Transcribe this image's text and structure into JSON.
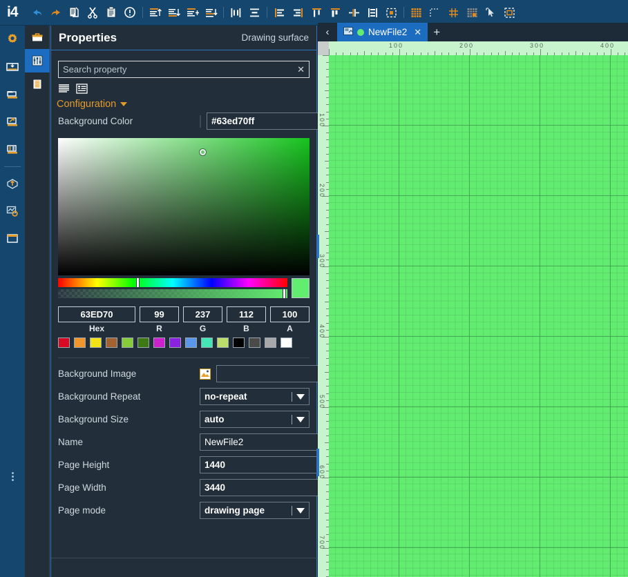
{
  "app": {
    "brand": "i4"
  },
  "toolbar": {
    "items": [
      {
        "name": "undo-icon",
        "label": "Undo"
      },
      {
        "name": "redo-icon",
        "label": "Redo"
      },
      {
        "name": "copy-icon",
        "label": "Copy"
      },
      {
        "name": "cut-icon",
        "label": "Cut"
      },
      {
        "name": "paste-icon",
        "label": "Paste"
      },
      {
        "name": "info-icon",
        "label": "Info"
      },
      {
        "name": "align-top-icon",
        "label": "Align top"
      },
      {
        "name": "align-bottom-icon",
        "label": "Align bottom"
      },
      {
        "name": "align-left-icon",
        "label": "Align left"
      },
      {
        "name": "align-right-icon",
        "label": "Align right"
      },
      {
        "name": "distribute-horizontal-icon",
        "label": "Distribute horizontally"
      },
      {
        "name": "distribute-vertical-icon",
        "label": "Distribute vertically"
      },
      {
        "name": "align-edge-left-icon",
        "label": "Align edge left"
      },
      {
        "name": "align-edge-right-icon",
        "label": "Align edge right"
      },
      {
        "name": "align-center-vertical-icon",
        "label": "Center vertically"
      },
      {
        "name": "align-center-horizontal-icon",
        "label": "Center horizontally"
      },
      {
        "name": "same-width-icon",
        "label": "Same width"
      },
      {
        "name": "same-height-icon",
        "label": "Same height"
      },
      {
        "name": "select-bounds-icon",
        "label": "Selection bounds"
      },
      {
        "name": "grid-icon",
        "label": "Grid"
      },
      {
        "name": "snap-guides-icon",
        "label": "Snap guides"
      },
      {
        "name": "guides-icon",
        "label": "Guides"
      },
      {
        "name": "grid-snap-icon",
        "label": "Snap to grid"
      },
      {
        "name": "pointer-icon",
        "label": "Pointer tool"
      },
      {
        "name": "group-select-icon",
        "label": "Group select"
      }
    ]
  },
  "rail": {
    "items": [
      {
        "name": "sidebar-item-settings",
        "label": "Settings"
      },
      {
        "name": "sidebar-item-dashboard",
        "label": "Dashboard"
      },
      {
        "name": "sidebar-item-open",
        "label": "Open"
      },
      {
        "name": "sidebar-item-export",
        "label": "Export"
      },
      {
        "name": "sidebar-item-reports",
        "label": "Reports"
      },
      {
        "name": "sidebar-item-deploy",
        "label": "Deploy"
      },
      {
        "name": "sidebar-item-chart-config",
        "label": "Chart configuration"
      },
      {
        "name": "sidebar-item-archive",
        "label": "Archive"
      }
    ]
  },
  "panel_tabs": {
    "items": [
      {
        "name": "panel-tab-toolbox",
        "label": "Toolbox",
        "active": false
      },
      {
        "name": "panel-tab-properties",
        "label": "Properties",
        "active": true
      },
      {
        "name": "panel-tab-list",
        "label": "List",
        "active": false
      }
    ]
  },
  "properties": {
    "title": "Properties",
    "subtitle": "Drawing surface",
    "search": {
      "value": "",
      "placeholder": "Search property",
      "clear": "✕"
    },
    "view_toggles": [
      {
        "name": "flat-list-view-toggle",
        "label": "Flat list"
      },
      {
        "name": "grouped-view-toggle",
        "label": "Grouped"
      }
    ],
    "group": {
      "label": "Configuration",
      "expanded": true
    },
    "fields": [
      {
        "name": "background-color",
        "label": "Background Color",
        "type": "color",
        "value": "#63ed70ff"
      },
      {
        "name": "background-image",
        "label": "Background Image",
        "type": "image",
        "value": ""
      },
      {
        "name": "background-repeat",
        "label": "Background Repeat",
        "type": "select",
        "value": "no-repeat"
      },
      {
        "name": "background-size",
        "label": "Background Size",
        "type": "select",
        "value": "auto"
      },
      {
        "name": "name",
        "label": "Name",
        "type": "text",
        "value": "NewFile2"
      },
      {
        "name": "page-height",
        "label": "Page Height",
        "type": "text",
        "value": "1440"
      },
      {
        "name": "page-width",
        "label": "Page Width",
        "type": "text",
        "value": "3440"
      },
      {
        "name": "page-mode",
        "label": "Page mode",
        "type": "select",
        "value": "drawing page"
      }
    ]
  },
  "color_picker": {
    "hex": "63ED70",
    "r": "99",
    "g": "237",
    "b": "112",
    "a": "100",
    "labels": {
      "hex": "Hex",
      "r": "R",
      "g": "G",
      "b": "B",
      "a": "A"
    },
    "preview": "#63ed70",
    "swatches": [
      "#d60a23",
      "#f0962d",
      "#f2e218",
      "#a26232",
      "#86cc3a",
      "#3d7a15",
      "#cc22cc",
      "#8a22e0",
      "#5a97e8",
      "#43e6b4",
      "#bbdd6a",
      "#000000",
      "#4a4a48",
      "#a8a8a8",
      "#ffffff"
    ]
  },
  "tabs": {
    "back": "‹",
    "add": "+",
    "items": [
      {
        "name": "tab-newfile2",
        "label": "NewFile2",
        "close": "✕",
        "active": true,
        "dot_color": "#63ed70"
      }
    ]
  },
  "canvas": {
    "h_ruler_labels": [
      "100",
      "200",
      "300",
      "400"
    ],
    "v_ruler_labels": [
      "100",
      "200",
      "300",
      "400",
      "500",
      "600",
      "700"
    ],
    "grid_color": "#63ed70",
    "ruler_color": "#c8f4cd"
  }
}
